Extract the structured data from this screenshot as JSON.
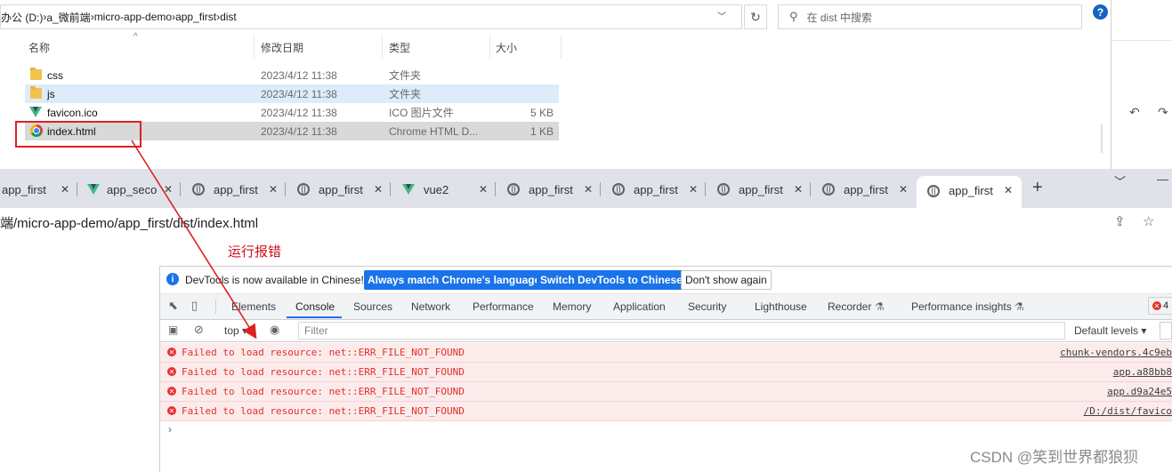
{
  "explorer": {
    "breadcrumb": [
      "办公 (D:)",
      "a_微前端",
      "micro-app-demo",
      "app_first",
      "dist"
    ],
    "search_placeholder": "在 dist 中搜索",
    "columns": [
      "名称",
      "修改日期",
      "类型",
      "大小"
    ],
    "files": [
      {
        "name": "css",
        "date": "2023/4/12 11:38",
        "type": "文件夹",
        "size": "",
        "icon": "folder-icon"
      },
      {
        "name": "js",
        "date": "2023/4/12 11:38",
        "type": "文件夹",
        "size": "",
        "icon": "folder-icon"
      },
      {
        "name": "favicon.ico",
        "date": "2023/4/12 11:38",
        "type": "ICO 图片文件",
        "size": "5 KB",
        "icon": "vue-logo-icon"
      },
      {
        "name": "index.html",
        "date": "2023/4/12 11:38",
        "type": "Chrome HTML D...",
        "size": "1 KB",
        "icon": "chrome-icon"
      }
    ]
  },
  "browser": {
    "tabs": [
      {
        "title": "app_first",
        "icon": "globe-icon",
        "active": false
      },
      {
        "title": "app_seco",
        "icon": "vue-logo-icon",
        "active": false
      },
      {
        "title": "app_first",
        "icon": "globe-icon",
        "active": false
      },
      {
        "title": "app_first",
        "icon": "globe-icon",
        "active": false
      },
      {
        "title": "vue2",
        "icon": "vue-logo-icon",
        "active": false
      },
      {
        "title": "app_first",
        "icon": "globe-icon",
        "active": false
      },
      {
        "title": "app_first",
        "icon": "globe-icon",
        "active": false
      },
      {
        "title": "app_first",
        "icon": "globe-icon",
        "active": false
      },
      {
        "title": "app_first",
        "icon": "globe-icon",
        "active": false
      },
      {
        "title": "app_first",
        "icon": "globe-icon",
        "active": true
      }
    ],
    "url": "端/micro-app-demo/app_first/dist/index.html"
  },
  "annotation": "运行报错",
  "devtools": {
    "infobar": {
      "text": "DevTools is now available in Chinese!",
      "btn_match": "Always match Chrome's language",
      "btn_switch": "Switch DevTools to Chinese",
      "btn_dismiss": "Don't show again"
    },
    "tabs": [
      "Elements",
      "Console",
      "Sources",
      "Network",
      "Performance",
      "Memory",
      "Application",
      "Security",
      "Lighthouse",
      "Recorder",
      "Performance insights"
    ],
    "active_tab": "Console",
    "error_count": "4",
    "console": {
      "context": "top",
      "filter_placeholder": "Filter",
      "levels": "Default levels",
      "errors": [
        {
          "message": "Failed to load resource: net::ERR_FILE_NOT_FOUND",
          "source": "chunk-vendors.4c9eb"
        },
        {
          "message": "Failed to load resource: net::ERR_FILE_NOT_FOUND",
          "source": "app.a88bb8"
        },
        {
          "message": "Failed to load resource: net::ERR_FILE_NOT_FOUND",
          "source": "app.d9a24e5"
        },
        {
          "message": "Failed to load resource: net::ERR_FILE_NOT_FOUND",
          "source": "/D:/dist/favico"
        }
      ],
      "prompt": "›"
    }
  },
  "watermark": "CSDN @笑到世界都狼狈",
  "colors": {
    "accent": "#1a73e8",
    "error": "#e23028",
    "annotation": "#d0101e"
  }
}
